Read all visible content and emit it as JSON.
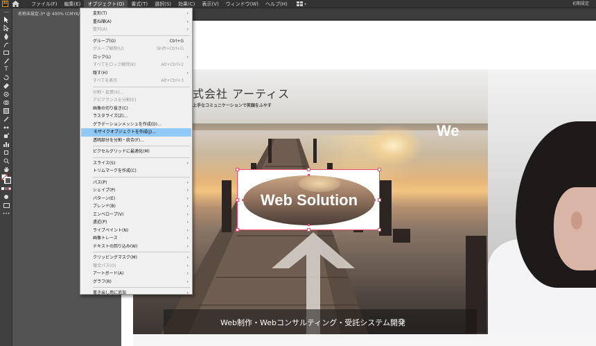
{
  "app": {
    "logo_text": "Ai",
    "menus": [
      "ファイル(F)",
      "編集(E)",
      "オブジェクト(O)",
      "書式(T)",
      "選択(S)",
      "効果(C)",
      "表示(V)",
      "ウィンドウ(W)",
      "ヘルプ(H)"
    ],
    "workspace": "初期設定"
  },
  "document": {
    "tab_title": "名称未設定-3* @ 400% (CMYK/..."
  },
  "artwork": {
    "company_name": "式会社 アーティス",
    "tagline": "上手なコミュニケーションで笑顔をふやす",
    "selected_title": "Web Solution",
    "right_title": "We",
    "cta_text": "Web制作・Webコンサルティング・受託システム開発",
    "cta_chevron": "〉"
  },
  "object_menu": {
    "groups": [
      [
        {
          "label": "変形(T)",
          "submenu": true
        },
        {
          "label": "重ね順(A)",
          "submenu": true
        },
        {
          "label": "整列(A)",
          "submenu": true,
          "disabled": true
        }
      ],
      [
        {
          "label": "グループ(G)",
          "shortcut": "Ctrl+G"
        },
        {
          "label": "グループ解除(U)",
          "shortcut": "Shift+Ctrl+G",
          "disabled": true
        },
        {
          "label": "ロック(L)",
          "submenu": true
        },
        {
          "label": "すべてをロック解除(K)",
          "shortcut": "Alt+Ctrl+2",
          "disabled": true
        },
        {
          "label": "隠す(H)",
          "submenu": true
        },
        {
          "label": "すべてを表示",
          "shortcut": "Alt+Ctrl+3",
          "disabled": true
        }
      ],
      [
        {
          "label": "分割・拡張(X)...",
          "disabled": true
        },
        {
          "label": "アピアランスを分割(E)",
          "disabled": true
        },
        {
          "label": "画像の切り抜き(C)"
        },
        {
          "label": "ラスタライズ(Z)..."
        },
        {
          "label": "グラデーションメッシュを作成(D)..."
        },
        {
          "label": "モザイクオブジェクトを作成(J)...",
          "highlight": true
        },
        {
          "label": "透明部分を分割・統合(F)..."
        }
      ],
      [
        {
          "label": "ピクセルグリッドに最適化(M)"
        }
      ],
      [
        {
          "label": "スライス(S)",
          "submenu": true
        },
        {
          "label": "トリムマークを作成(C)"
        }
      ],
      [
        {
          "label": "パス(P)",
          "submenu": true
        },
        {
          "label": "シェイプ(P)",
          "submenu": true
        },
        {
          "label": "パターン(E)",
          "submenu": true
        },
        {
          "label": "ブレンド(B)",
          "submenu": true
        },
        {
          "label": "エンベロープ(V)",
          "submenu": true
        },
        {
          "label": "遠近(P)",
          "submenu": true
        },
        {
          "label": "ライブペイント(N)",
          "submenu": true
        },
        {
          "label": "画像トレース",
          "submenu": true
        },
        {
          "label": "テキストの回り込み(W)",
          "submenu": true
        }
      ],
      [
        {
          "label": "クリッピングマスク(M)",
          "submenu": true
        },
        {
          "label": "複合パス(O)",
          "submenu": true,
          "disabled": true
        },
        {
          "label": "アートボード(A)",
          "submenu": true
        },
        {
          "label": "グラフ(R)",
          "submenu": true
        }
      ],
      [
        {
          "label": "書き出し用に追加",
          "submenu": true
        }
      ]
    ]
  },
  "colors": {
    "selection": "#e84a6b",
    "menu_highlight": "#91c9f7",
    "chrome": "#323232"
  }
}
